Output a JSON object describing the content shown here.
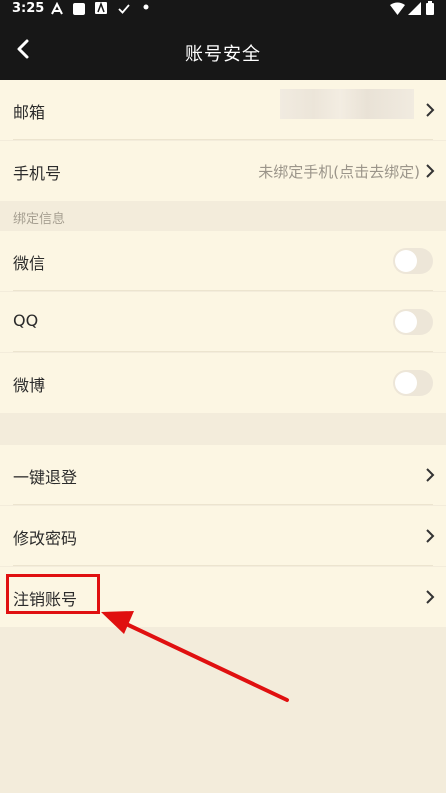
{
  "status_bar": {
    "time": "3:25"
  },
  "header": {
    "title": "账号安全"
  },
  "account": {
    "email_label": "邮箱",
    "phone_label": "手机号",
    "phone_value": "未绑定手机(点击去绑定)"
  },
  "binding": {
    "section_title": "绑定信息",
    "items": [
      {
        "label": "微信",
        "enabled": false
      },
      {
        "label": "QQ",
        "enabled": false
      },
      {
        "label": "微博",
        "enabled": false
      }
    ]
  },
  "actions": {
    "logout_all": "一键退登",
    "change_password": "修改密码",
    "delete_account": "注销账号"
  },
  "colors": {
    "header_bg": "#171717",
    "row_bg": "#fcf6e3",
    "annotation": "#e01010"
  }
}
